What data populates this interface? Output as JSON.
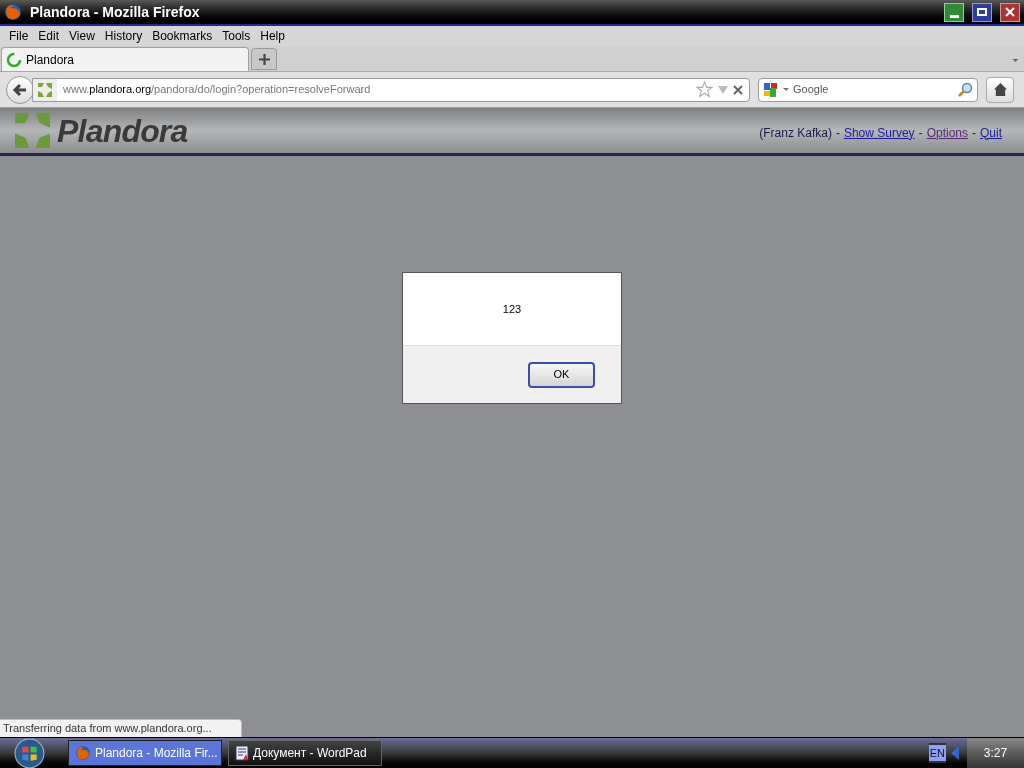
{
  "window": {
    "title": "Plandora - Mozilla Firefox"
  },
  "menu": [
    "File",
    "Edit",
    "View",
    "History",
    "Bookmarks",
    "Tools",
    "Help"
  ],
  "tabs": [
    {
      "label": "Plandora",
      "selected": true,
      "loading": true
    }
  ],
  "url": {
    "prefix": "www.",
    "domain": "plandora.org",
    "path": "/pandora/do/login?operation=resolveForward"
  },
  "search": {
    "placeholder": "Google"
  },
  "page_header": {
    "logo": "Plandora",
    "nav": [
      {
        "kind": "text",
        "text": "(Franz Kafka)"
      },
      {
        "kind": "separator",
        "text": "-"
      },
      {
        "kind": "link",
        "text": "Show Survey",
        "visited": false
      },
      {
        "kind": "separator",
        "text": "-"
      },
      {
        "kind": "link",
        "text": "Options",
        "visited": true
      },
      {
        "kind": "separator",
        "text": "-"
      },
      {
        "kind": "link",
        "text": "Quit",
        "visited": false
      }
    ]
  },
  "alert": {
    "message": "123",
    "button": "OK"
  },
  "status_bar": "Transferring data from www.plandora.org...",
  "taskbar": {
    "items": [
      {
        "label": "Plandora - Mozilla Fir...",
        "selected": true,
        "kind": "firefox"
      },
      {
        "label": "Документ - WordPad",
        "selected": false,
        "kind": "wordpad"
      }
    ],
    "language": "EN",
    "clock": "3:27"
  }
}
